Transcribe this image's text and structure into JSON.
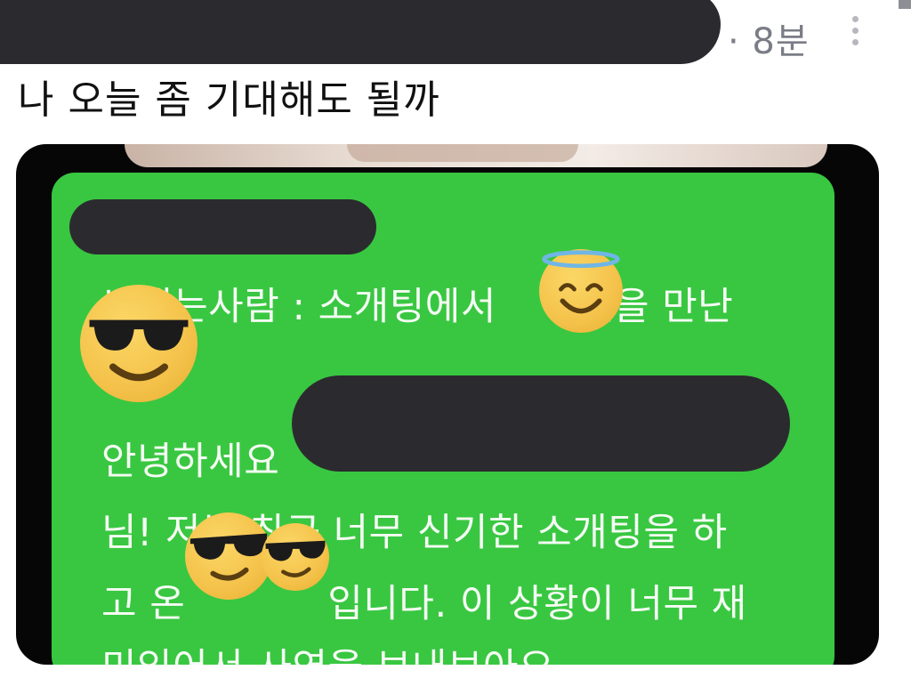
{
  "header": {
    "time": "· 8분",
    "more_icon": "kebab-more-icon"
  },
  "post": {
    "text": "나 오늘 좀 기대해도 될까"
  },
  "card": {
    "line_sender": "보내는사람 : 소개팅에서",
    "line_sender_tail": "팬을 만난",
    "line_greeting": "안녕하세요",
    "line_2": "님! 저는 최근 너무 신기한 소개팅을 하",
    "line_3_head": "고 온",
    "line_3_tail": "입니다. 이 상황이 너무 재",
    "line_4": "미있어서 사연을 보내보아요.",
    "emojis": [
      "smiling-face-with-halo",
      "smiling-face-with-sunglasses",
      "smiling-face-with-sunglasses",
      "smiling-face-with-sunglasses"
    ]
  },
  "colors": {
    "card_green": "#39c741",
    "redaction": "#2b2b2f",
    "meta_gray": "#7a7d86"
  }
}
